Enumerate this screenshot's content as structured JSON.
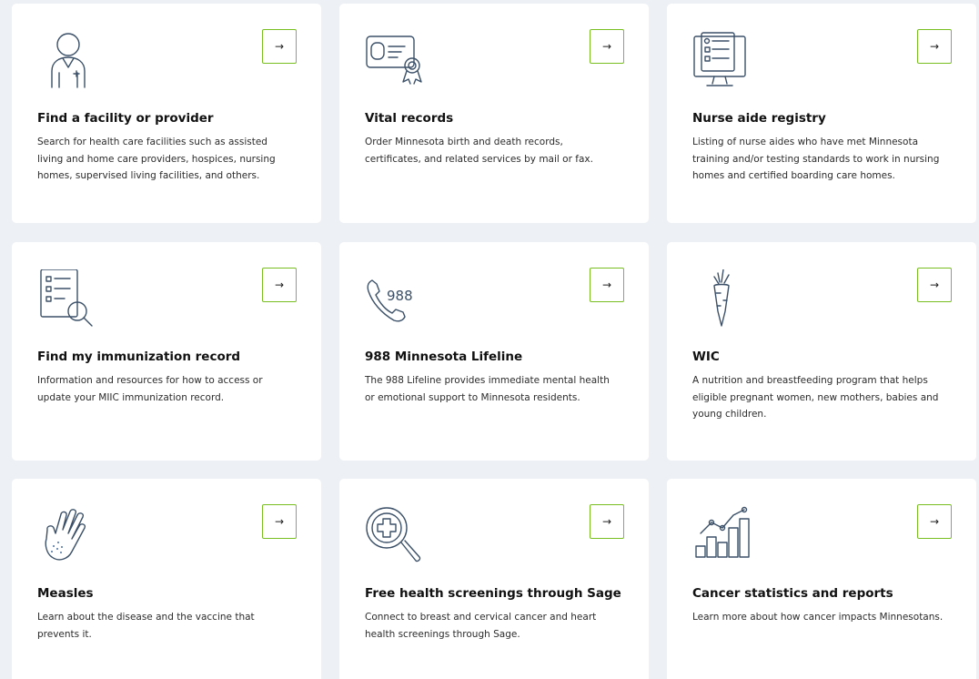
{
  "cards": [
    {
      "icon": "doctor-icon",
      "title": "Find a facility or provider",
      "description": "Search for health care facilities such as assisted living and home care providers, hospices, nursing homes, supervised living facilities, and others."
    },
    {
      "icon": "vital-records-certificate-icon",
      "title": "Vital records",
      "description": "Order Minnesota birth and death records, certificates, and related services by mail or fax."
    },
    {
      "icon": "computer-registry-icon",
      "title": "Nurse aide registry",
      "description": "Listing of nurse aides who have met Minnesota training and/or testing standards to work in nursing homes and certified boarding care homes."
    },
    {
      "icon": "checklist-search-icon",
      "title": "Find my immunization record",
      "description": "Information and resources for how to access or update your MIIC immunization record."
    },
    {
      "icon": "phone-988-icon",
      "icon_text": "988",
      "title": "988 Minnesota Lifeline",
      "description": "The 988 Lifeline provides immediate mental health or emotional support to Minnesota residents."
    },
    {
      "icon": "carrot-icon",
      "title": "WIC",
      "description": "A nutrition and breastfeeding program that helps eligible pregnant women, new mothers, babies and young children."
    },
    {
      "icon": "rash-hand-icon",
      "title": "Measles",
      "description": "Learn about the disease and the vaccine that prevents it."
    },
    {
      "icon": "magnifier-cross-icon",
      "title": "Free health screenings through Sage",
      "description": "Connect to breast and cervical cancer and heart health screenings through Sage."
    },
    {
      "icon": "bar-line-chart-icon",
      "title": "Cancer statistics and reports",
      "description": "Learn more about how cancer impacts Minnesotans."
    }
  ],
  "arrow_glyph": "→",
  "colors": {
    "background": "#edf0f5",
    "card": "#ffffff",
    "arrow_border": "#78be20",
    "icon_stroke": "#3b5068"
  }
}
